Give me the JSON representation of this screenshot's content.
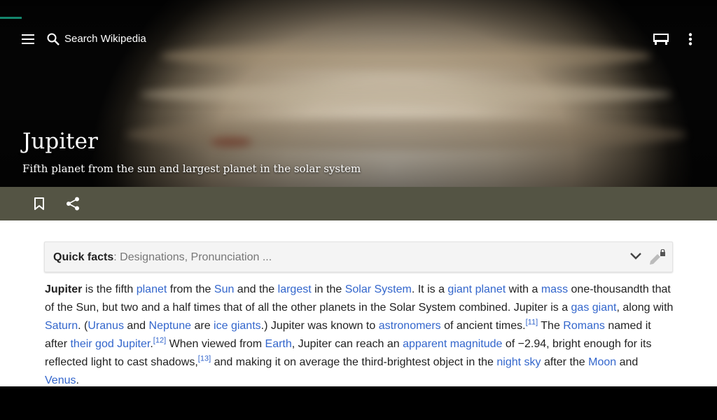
{
  "toolbar": {
    "search_placeholder": "Search Wikipedia",
    "icons": [
      "menu-icon",
      "search-icon",
      "reading-lists-icon",
      "overflow-menu-icon"
    ]
  },
  "colors": {
    "progress": "#14866d",
    "action_bar": "#545444",
    "link": "#3366cc",
    "text": "#222222"
  },
  "page": {
    "title": "Jupiter",
    "description": "Fifth planet from the sun and largest planet in the solar system"
  },
  "actions": {
    "icons": [
      "bookmark-icon",
      "share-icon"
    ]
  },
  "quick_facts": {
    "label": "Quick facts",
    "separator": ": ",
    "summary": "Designations, Pronunciation ..."
  },
  "article": {
    "s1_bold": "Jupiter",
    "s1_a": " is the fifth ",
    "l_planet": "planet",
    "s1_b": " from the ",
    "l_sun": "Sun",
    "s1_c": " and the ",
    "l_largest": "largest",
    "s1_d": " in the ",
    "l_solar_system": "Solar System",
    "s2_a": ". It is a ",
    "l_giant_planet": "giant planet",
    "s2_b": " with a ",
    "l_mass": "mass",
    "s2_c": " one-thousandth that of the Sun, but two and a half times that of all the other planets in the Solar System combined. Jupiter is a ",
    "l_gas_giant": "gas giant",
    "s2_d": ", along with ",
    "l_saturn": "Saturn",
    "s2_e": ". (",
    "l_uranus": "Uranus",
    "s2_f": " and ",
    "l_neptune": "Neptune",
    "s2_g": " are ",
    "l_ice_giants": "ice giants",
    "s2_h": ".) Jupiter was known to ",
    "l_astronomers": "astronomers",
    "s2_i": " of ancient times.",
    "ref11": "[11]",
    "s3_a": " The ",
    "l_romans": "Romans",
    "s3_b": " named it after ",
    "l_their_god_jupiter": "their god Jupiter",
    "s3_c": ".",
    "ref12": "[12]",
    "s4_a": " When viewed from ",
    "l_earth": "Earth",
    "s4_b": ", Jupiter can reach an ",
    "l_apparent_magnitude": "apparent magnitude",
    "s4_c": " of −2.94, bright enough for its reflected light to cast shadows,",
    "ref13": "[13]",
    "s4_d": " and making it on average the third-brightest object in the ",
    "l_night_sky": "night sky",
    "s4_e": " after the ",
    "l_moon": "Moon",
    "s4_f": " and ",
    "l_venus": "Venus",
    "s4_g": "."
  }
}
